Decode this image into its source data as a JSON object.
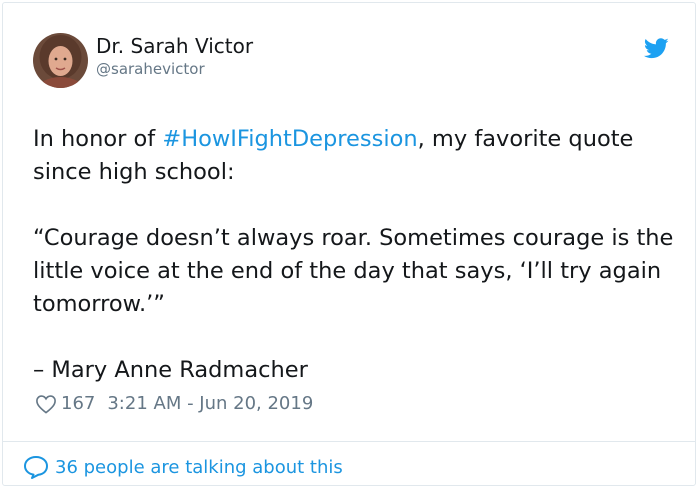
{
  "author": {
    "name": "Dr. Sarah Victor",
    "handle": "@sarahevictor"
  },
  "tweet": {
    "text_prefix": "In honor of ",
    "hashtag": "#HowIFightDepression",
    "text_suffix": ", my favorite quote since high school:",
    "quote": "“Courage doesn’t always roar. Sometimes courage is the little voice at the end of the day that says, ‘I’ll try again tomorrow.’”",
    "attribution": "– Mary Anne Radmacher"
  },
  "meta": {
    "likes": "167",
    "timestamp": "3:21 AM - Jun 20, 2019"
  },
  "footer": {
    "conversation_label": "36 people are talking about this"
  },
  "colors": {
    "accent": "#1b95e0",
    "secondary_text": "#657786",
    "divider": "#e1e8ed"
  },
  "icons": {
    "brand": "twitter-bird-icon",
    "like": "heart-icon",
    "reply": "speech-bubble-icon"
  }
}
